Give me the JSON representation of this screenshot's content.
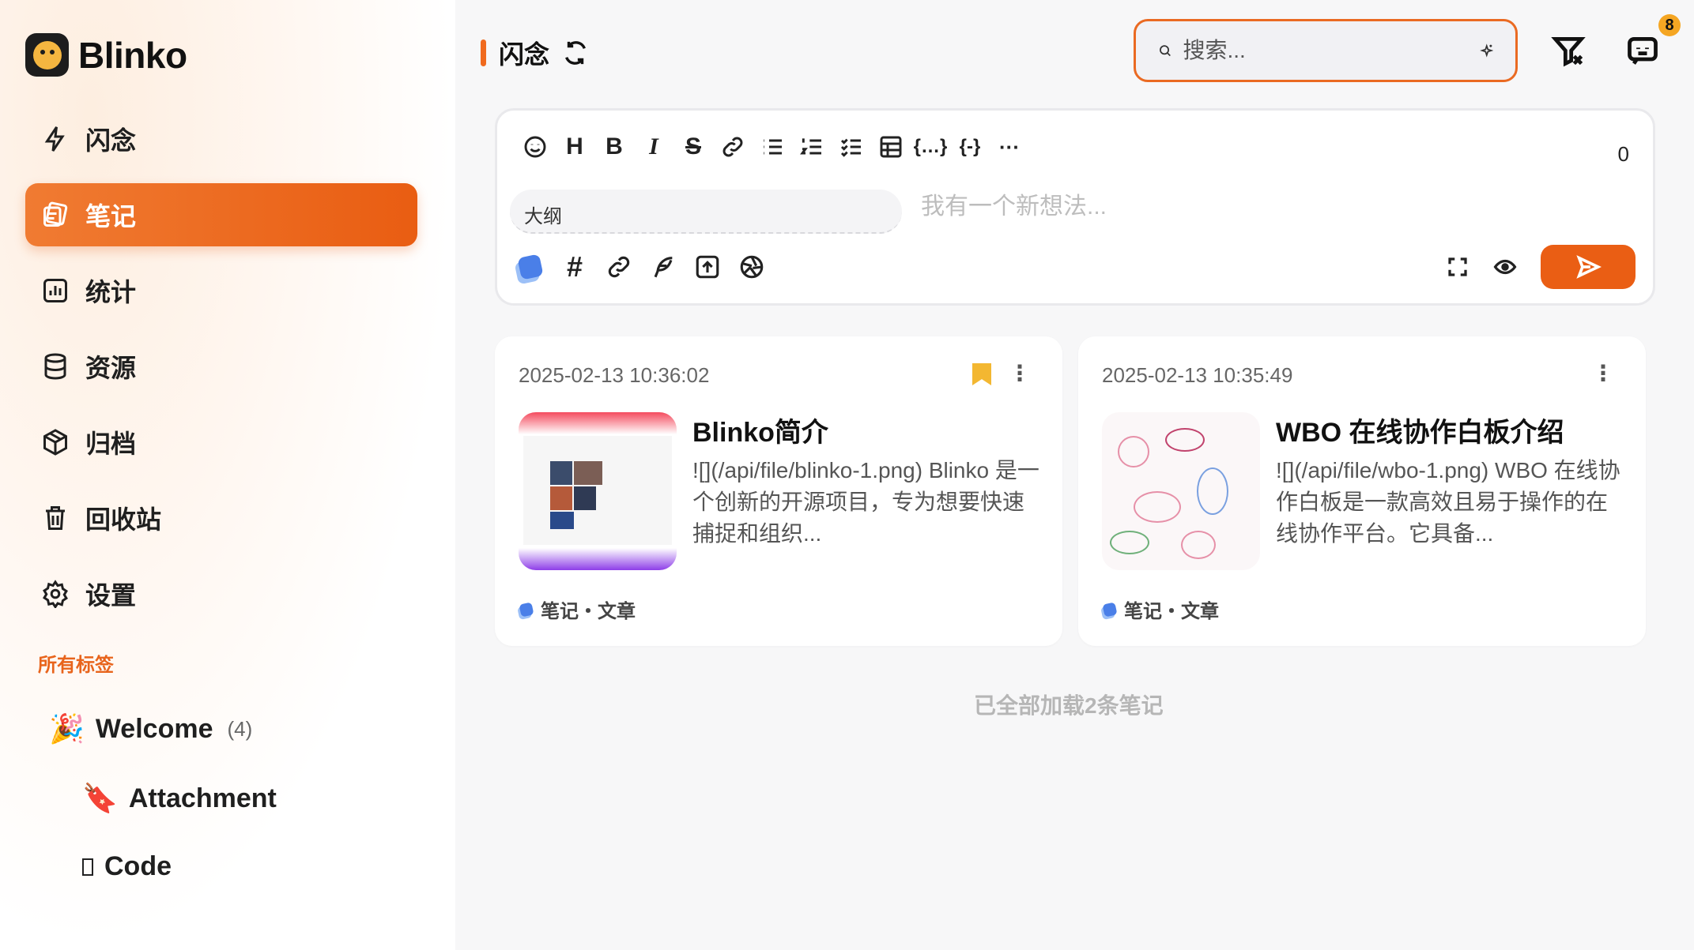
{
  "app": {
    "name": "Blinko"
  },
  "sidebar": {
    "items": [
      {
        "label": "闪念",
        "icon": "flash-icon",
        "active": false
      },
      {
        "label": "笔记",
        "icon": "note-icon",
        "active": true
      },
      {
        "label": "统计",
        "icon": "chart-icon",
        "active": false
      },
      {
        "label": "资源",
        "icon": "database-icon",
        "active": false
      },
      {
        "label": "归档",
        "icon": "archive-box-icon",
        "active": false
      },
      {
        "label": "回收站",
        "icon": "trash-icon",
        "active": false
      },
      {
        "label": "设置",
        "icon": "gear-icon",
        "active": false
      }
    ],
    "tags_title": "所有标签",
    "tags": [
      {
        "emoji": "🎉",
        "label": "Welcome",
        "count": "(4)"
      },
      {
        "emoji": "🔖",
        "label": "Attachment"
      },
      {
        "emoji": "",
        "label": "Code"
      }
    ]
  },
  "header": {
    "title": "闪念",
    "search_placeholder": "搜索...",
    "notification_count": "8"
  },
  "editor": {
    "char_count": "0",
    "outline_label": "大纲",
    "placeholder": "我有一个新想法...",
    "toolbar": [
      "smile-icon",
      "heading",
      "bold",
      "italic",
      "strikethrough",
      "link-icon",
      "bullet-list-icon",
      "ordered-list-icon",
      "check-list-icon",
      "table-icon",
      "code-block-icon",
      "inline-code-icon",
      "more-icon"
    ]
  },
  "notes": [
    {
      "date": "2025-02-13 10:36:02",
      "title": "Blinko简介",
      "body": "![](/api/file/blinko-1.png) Blinko 是一个创新的开源项目，专为想要快速捕捉和组织...",
      "tags": "笔记・文章",
      "bookmarked": true
    },
    {
      "date": "2025-02-13 10:35:49",
      "title": "WBO 在线协作白板介绍",
      "body": "![](/api/file/wbo-1.png) WBO 在线协作白板是一款高效且易于操作的在线协作平台。它具备...",
      "tags": "笔记・文章",
      "bookmarked": false
    }
  ],
  "footer": {
    "loaded_text": "已全部加载2条笔记"
  },
  "colors": {
    "accent": "#ea5e14",
    "bookmark": "#f3b731",
    "tag_blue": "#4a7fe8"
  }
}
